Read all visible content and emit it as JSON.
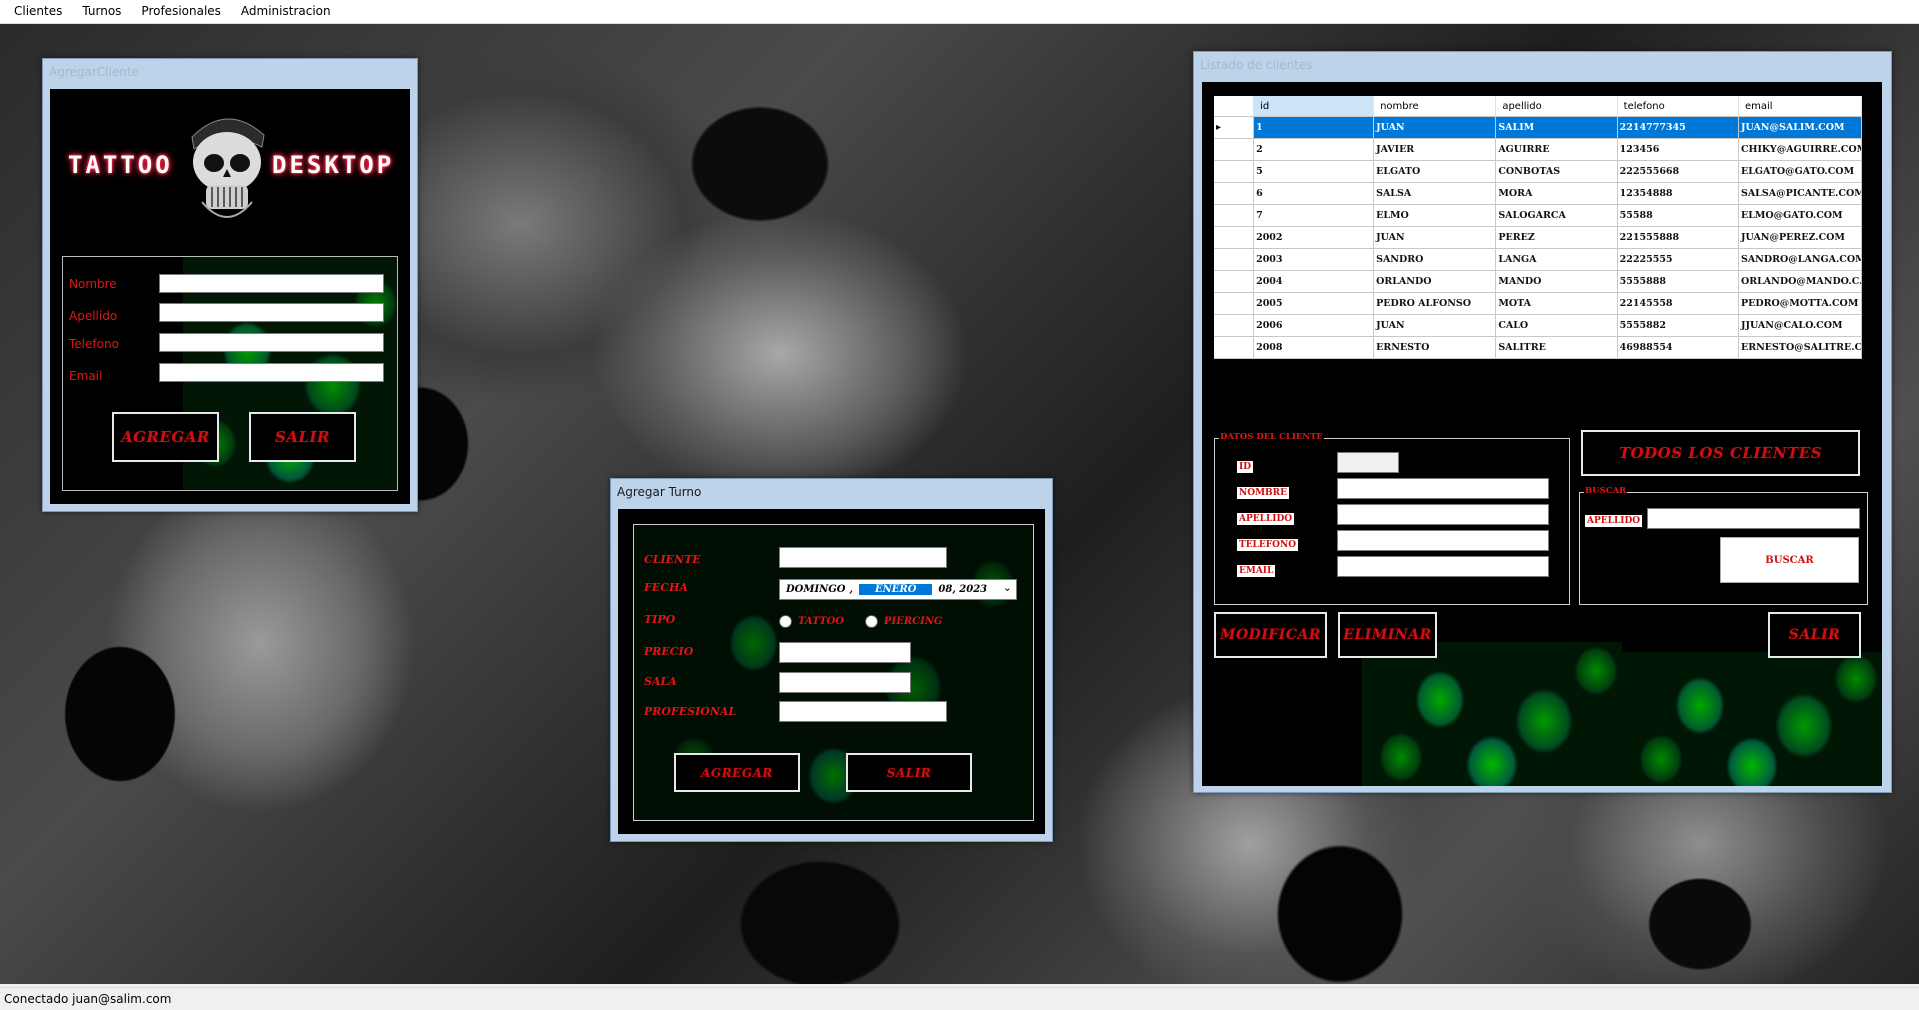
{
  "menu": {
    "items": [
      "Clientes",
      "Turnos",
      "Profesionales",
      "Administracion"
    ]
  },
  "agregar_cliente": {
    "title": "AgregarCliente",
    "logo_left": "TATTOO",
    "logo_right": "DESKTOP",
    "labels": {
      "nombre": "Nombre",
      "apellido": "Apellido",
      "telefono": "Telefono",
      "email": "Email"
    },
    "buttons": {
      "agregar": "AGREGAR",
      "salir": "SALIR"
    }
  },
  "agregar_turno": {
    "title": "Agregar Turno",
    "labels": {
      "cliente": "CLIENTE",
      "fecha": "FECHA",
      "tipo": "TIPO",
      "precio": "PRECIO",
      "sala": "SALA",
      "profesional": "PROFESIONAL"
    },
    "date": {
      "weekday": "DOMINGO",
      "sep": ",",
      "month": "ENERO",
      "dayyear": "08, 2023"
    },
    "tipo_options": [
      "TATTOO",
      "PIERCING"
    ],
    "buttons": {
      "agregar": "AGREGAR",
      "salir": "SALIR"
    }
  },
  "listado": {
    "title": "Listado de clientes",
    "columns": [
      "id",
      "nombre",
      "apellido",
      "telefono",
      "email"
    ],
    "rows": [
      [
        "1",
        "JUAN",
        "SALIM",
        "2214777345",
        "JUAN@SALIM.COM"
      ],
      [
        "2",
        "JAVIER",
        "AGUIRRE",
        "123456",
        "CHIKY@AGUIRRE.COM"
      ],
      [
        "5",
        "ELGATO",
        "CONBOTAS",
        "222555668",
        "ELGATO@GATO.COM"
      ],
      [
        "6",
        "SALSA",
        "MORA",
        "12354888",
        "SALSA@PICANTE.COM"
      ],
      [
        "7",
        "ELMO",
        "SALOGARCA",
        "55588",
        "ELMO@GATO.COM"
      ],
      [
        "2002",
        "JUAN",
        "PEREZ",
        "221555888",
        "JUAN@PEREZ.COM"
      ],
      [
        "2003",
        "SANDRO",
        "LANGA",
        "22225555",
        "SANDRO@LANGA.COM"
      ],
      [
        "2004",
        "ORLANDO",
        "MANDO",
        "5555888",
        "ORLANDO@MANDO.C..."
      ],
      [
        "2005",
        "PEDRO ALFONSO",
        "MOTA",
        "22145558",
        "PEDRO@MOTTA.COM"
      ],
      [
        "2006",
        "JUAN",
        "CALO",
        "5555882",
        "JJUAN@CALO.COM"
      ],
      [
        "2008",
        "ERNESTO",
        "SALITRE",
        "46988554",
        "ERNESTO@SALITRE.C..."
      ]
    ],
    "selected_row_index": 0,
    "datos": {
      "legend": "DATOS DEL CLIENTE",
      "labels": {
        "id": "ID",
        "nombre": "NOMBRE",
        "apellido": "APELLIDO",
        "telefono": "TELEFONO",
        "email": "EMAIL"
      }
    },
    "buscar": {
      "legend": "BUSCAR",
      "label": "APELLIDO",
      "button": "BUSCAR"
    },
    "buttons": {
      "todos": "TODOS LOS CLIENTES",
      "modificar": "MODIFICAR",
      "eliminar": "ELIMINAR",
      "salir": "SALIR"
    }
  },
  "status": {
    "text": "Conectado juan@salim.com"
  },
  "colors": {
    "accent_red": "#e01616",
    "selection_blue": "#0078d7",
    "window_frame": "#bcd3ea"
  }
}
